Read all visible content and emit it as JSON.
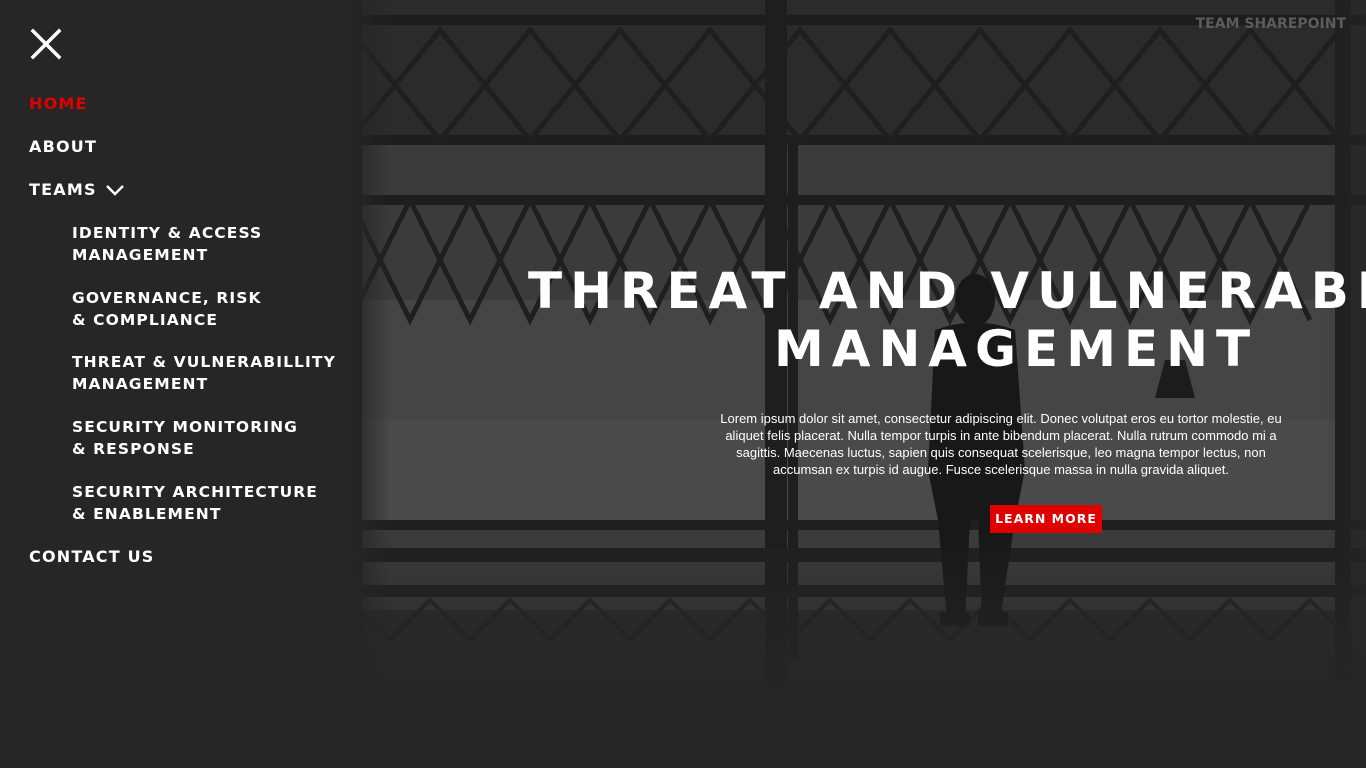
{
  "brand": {
    "label": "TEAM SHAREPOINT"
  },
  "colors": {
    "accent": "#e00000",
    "background": "#262626",
    "text": "#ffffff",
    "muted": "#5c5c5c"
  },
  "icons": {
    "close": "close-icon",
    "teams_toggle": "chevron-down-icon"
  },
  "nav": {
    "home": "HOME",
    "about": "ABOUT",
    "teams": "TEAMS",
    "contact": "CONTACT US",
    "teams_items": [
      {
        "line1": "IDENTITY & ACCESS",
        "line2": "MANAGEMENT"
      },
      {
        "line1": "GOVERNANCE, RISK",
        "line2": "& COMPLIANCE"
      },
      {
        "line1": "THREAT & VULNERABILLITY",
        "line2": "MANAGEMENT"
      },
      {
        "line1": "SECURITY MONITORING",
        "line2": "& RESPONSE"
      },
      {
        "line1": "SECURITY ARCHITECTURE",
        "line2": "& ENABLEMENT"
      }
    ]
  },
  "hero": {
    "title_line1": "THREAT AND VULNERABILITY",
    "title_line2": "MANAGEMENT",
    "body": "Lorem ipsum dolor sit amet, consectetur adipiscing elit. Donec volutpat eros eu tortor molestie, eu aliquet felis placerat. Nulla tempor turpis in ante bibendum placerat. Nulla rutrum commodo mi a sagittis. Maecenas luctus, sapien quis consequat scelerisque, leo magna tempor lectus, non accumsan ex turpis id augue. Fusce scelerisque massa in nulla gravida aliquet.",
    "cta": "LEARN MORE"
  }
}
